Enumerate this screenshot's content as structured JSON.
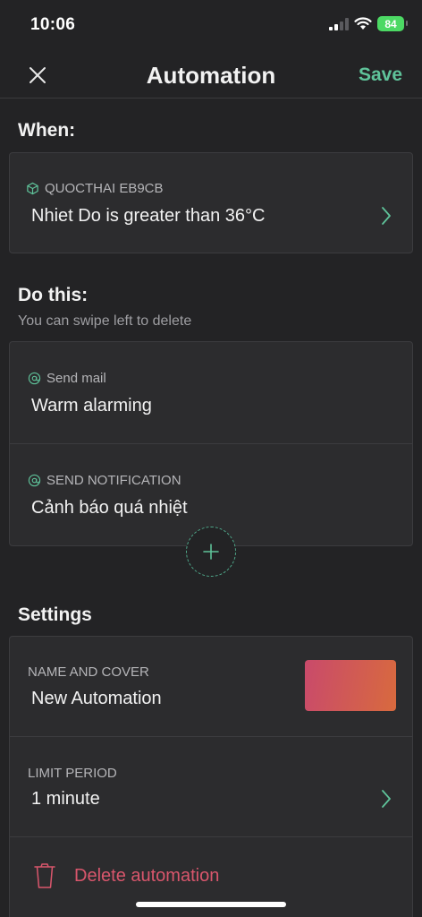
{
  "status_bar": {
    "time": "10:06",
    "battery": "84"
  },
  "nav": {
    "title": "Automation",
    "save_label": "Save"
  },
  "when": {
    "heading": "When:",
    "device_label": "QUOCTHAI EB9CB",
    "condition": "Nhiet Do is greater than 36°C"
  },
  "do_this": {
    "heading": "Do this:",
    "hint": "You can swipe left to delete",
    "actions": [
      {
        "type_label": "Send mail",
        "value": "Warm alarming"
      },
      {
        "type_label": "SEND NOTIFICATION",
        "value": "Cảnh báo quá nhiệt"
      }
    ]
  },
  "settings": {
    "heading": "Settings",
    "name_label": "NAME AND COVER",
    "name_value": "New Automation",
    "limit_label": "LIMIT PERIOD",
    "limit_value": "1 minute",
    "delete_label": "Delete automation"
  },
  "colors": {
    "accent": "#5fc39a",
    "danger": "#d9566c",
    "cover_gradient_start": "#c94a6b",
    "cover_gradient_end": "#d86a3e"
  }
}
